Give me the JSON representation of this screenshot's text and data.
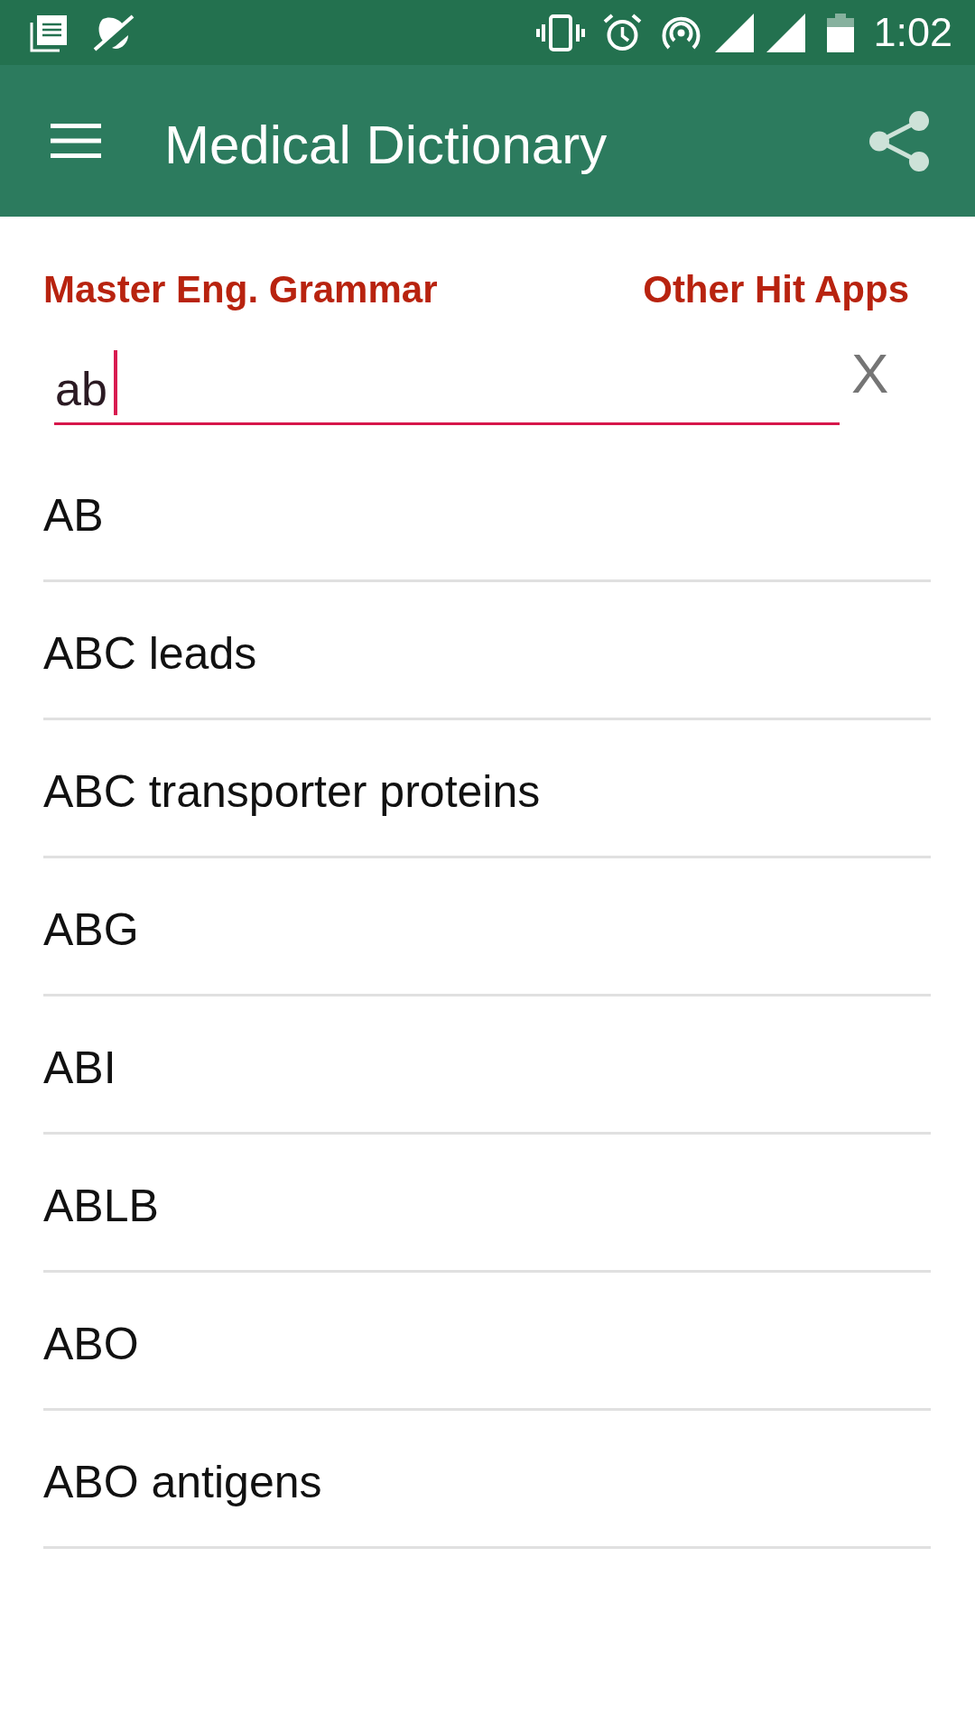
{
  "status_bar": {
    "time": "1:02"
  },
  "app_bar": {
    "title": "Medical Dictionary"
  },
  "links": [
    {
      "label": "Master Eng. Grammar"
    },
    {
      "label": "Other Hit Apps"
    }
  ],
  "search": {
    "value": "ab",
    "focused": true,
    "clear_button": "X"
  },
  "results": [
    "AB",
    "ABC leads",
    "ABC transporter proteins",
    "ABG",
    "ABI",
    "ABLB",
    "ABO",
    "ABO antigens"
  ]
}
